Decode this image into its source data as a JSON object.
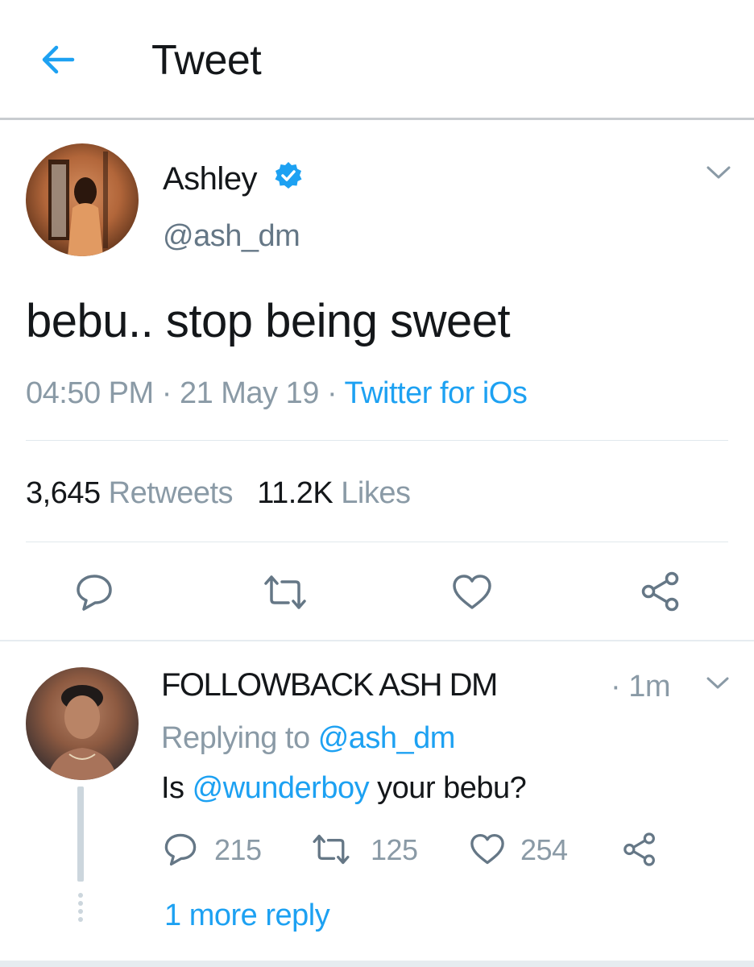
{
  "header": {
    "title": "Tweet",
    "back_icon": "back-arrow-icon"
  },
  "tweet": {
    "author_name": "Ashley",
    "verified_icon": "verified-badge-icon",
    "handle": "@ash_dm",
    "text": "bebu.. stop being sweet",
    "time": "04:50 PM",
    "date": "21 May 19",
    "separator": "·",
    "source": "Twitter for iOs",
    "retweets_count": "3,645",
    "retweets_label": "Retweets",
    "likes_count": "11.2K",
    "likes_label": "Likes",
    "actions": [
      "reply-icon",
      "retweet-icon",
      "like-icon",
      "share-icon"
    ]
  },
  "reply": {
    "author_name": "FOLLOWBACK ASH DM",
    "time": "· 1m",
    "replying_prefix": "Replying to",
    "replying_handle": "@ash_dm",
    "body_prefix": "Is",
    "body_mention": "@wunderboy",
    "body_suffix": "your bebu?",
    "reply_count": "215",
    "retweet_count": "125",
    "like_count": "254",
    "more_replies": "1 more reply"
  },
  "colors": {
    "accent": "#1da1f2",
    "text_primary": "#14171a",
    "text_secondary": "#8a9aa6",
    "icon": "#657786",
    "divider": "#e1e8ed"
  }
}
